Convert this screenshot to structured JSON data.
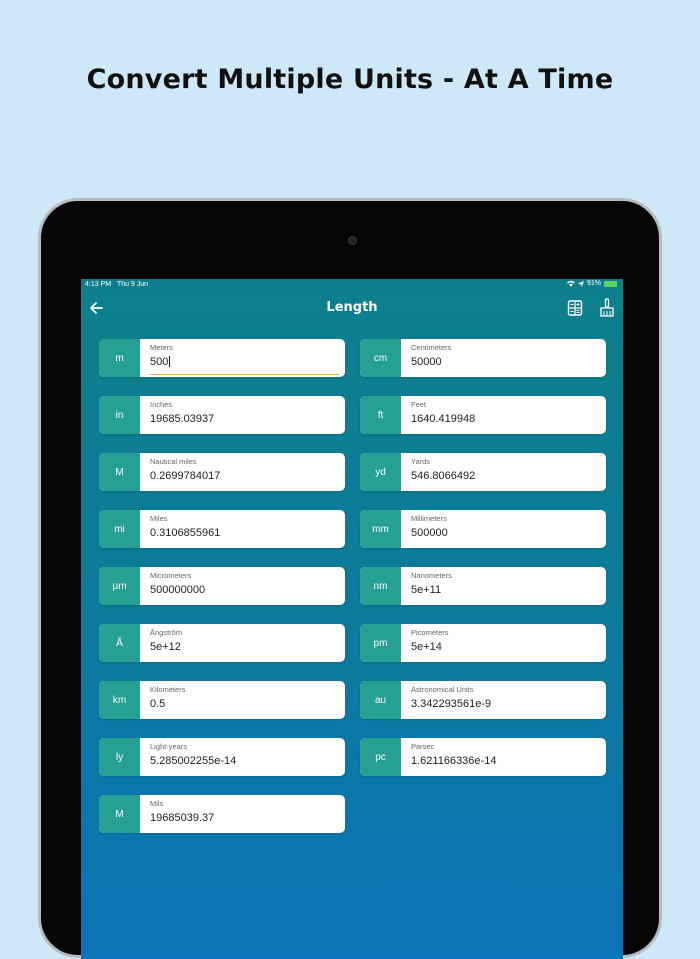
{
  "promo": {
    "title": "Convert Multiple Units - At A Time"
  },
  "status_bar": {
    "time": "4:13 PM",
    "date": "Thu 9 Jun",
    "battery": "91%"
  },
  "app_bar": {
    "title": "Length"
  },
  "units": [
    {
      "abbr": "m",
      "name": "Meters",
      "value": "500"
    },
    {
      "abbr": "cm",
      "name": "Centimeters",
      "value": "50000"
    },
    {
      "abbr": "in",
      "name": "Inches",
      "value": "19685.03937"
    },
    {
      "abbr": "ft",
      "name": "Feet",
      "value": "1640.419948"
    },
    {
      "abbr": "M",
      "name": "Nautical miles",
      "value": "0.2699784017"
    },
    {
      "abbr": "yd",
      "name": "Yards",
      "value": "546.8066492"
    },
    {
      "abbr": "mi",
      "name": "Miles",
      "value": "0.3106855961"
    },
    {
      "abbr": "mm",
      "name": "Millimeters",
      "value": "500000"
    },
    {
      "abbr": "µm",
      "name": "Micrometers",
      "value": "500000000"
    },
    {
      "abbr": "nm",
      "name": "Nanometers",
      "value": "5e+11"
    },
    {
      "abbr": "Å",
      "name": "Ångström",
      "value": "5e+12"
    },
    {
      "abbr": "pm",
      "name": "Picometers",
      "value": "5e+14"
    },
    {
      "abbr": "km",
      "name": "Kilometers",
      "value": "0.5"
    },
    {
      "abbr": "au",
      "name": "Astronomical Units",
      "value": "3.342293561e-9"
    },
    {
      "abbr": "ly",
      "name": "Light-years",
      "value": "5.285002255e-14"
    },
    {
      "abbr": "pc",
      "name": "Parsec",
      "value": "1.621166336e-14"
    },
    {
      "abbr": "M",
      "name": "Mils",
      "value": "19685039.37"
    }
  ],
  "icons": {
    "back": "arrow-left-icon",
    "calculator": "calculator-icon",
    "clear": "broom-icon",
    "wifi": "wifi-icon",
    "location": "location-arrow-icon",
    "battery": "battery-icon"
  },
  "colors": {
    "accent": "#25a093",
    "background": "#cfe8f8",
    "active_underline": "#f0b040"
  }
}
